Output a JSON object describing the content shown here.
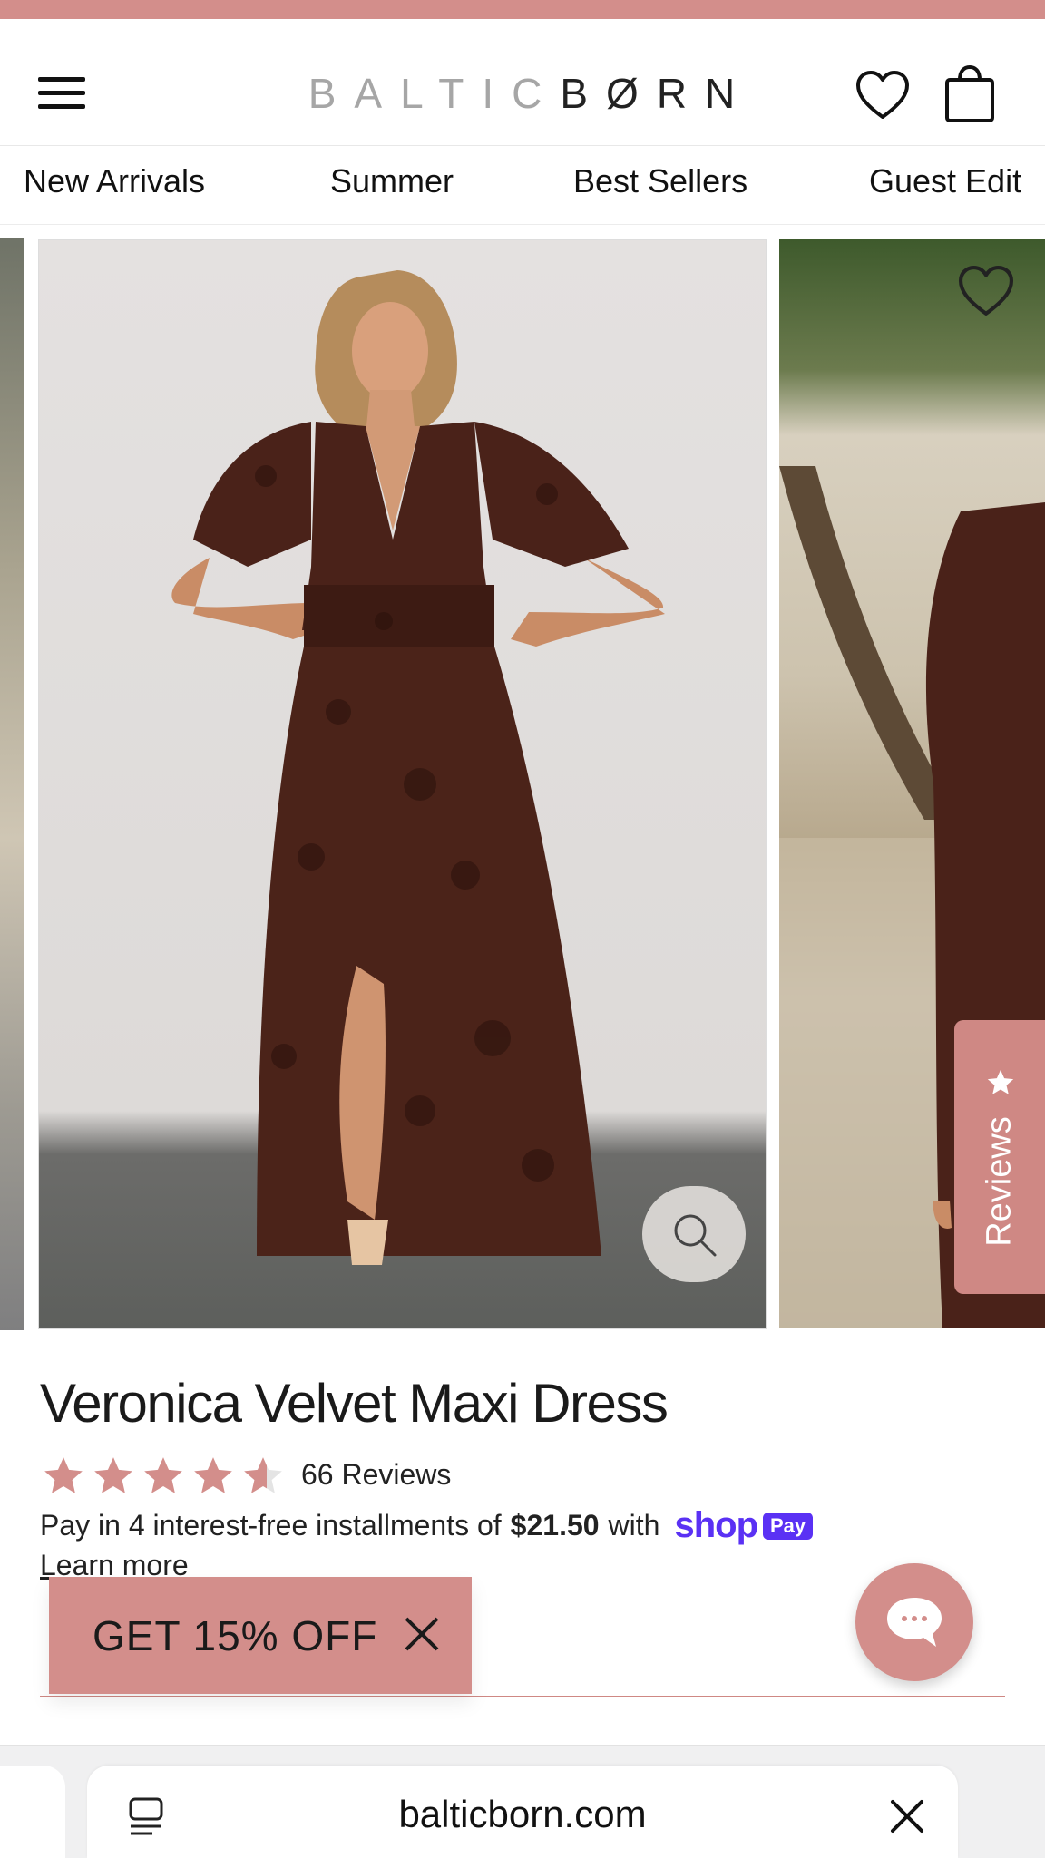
{
  "header": {
    "brand_light": "BALTIC",
    "brand_dark": "BØRN"
  },
  "nav": {
    "items": [
      "New Arrivals",
      "Summer",
      "Best Sellers",
      "Guest Edit"
    ]
  },
  "reviews_tab": {
    "label": "Reviews"
  },
  "product": {
    "title": "Veronica Velvet Maxi Dress",
    "rating": 4.6,
    "rating_max": 5,
    "review_count_label": "66 Reviews",
    "installments_prefix": "Pay in 4 interest-free installments of",
    "installment_amount": "$21.50",
    "installments_with": "with",
    "shop_logo": "shop",
    "pay_badge": "Pay",
    "learn_more": "Learn more"
  },
  "promo": {
    "label": "GET 15% OFF"
  },
  "browser": {
    "url": "balticborn.com"
  },
  "colors": {
    "accent": "#d38e8b",
    "shop_pay": "#5a31f4",
    "dress": "#4a2219"
  },
  "icons": [
    "menu-icon",
    "heart-icon",
    "shopping-bag-icon",
    "search-icon",
    "star-icon",
    "close-icon",
    "chat-icon",
    "tabs-icon"
  ]
}
